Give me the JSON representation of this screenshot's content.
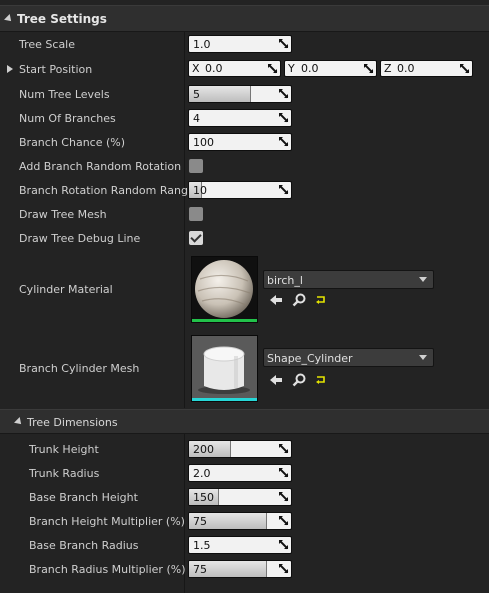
{
  "tree_settings": {
    "title": "Tree Settings",
    "tree_scale": {
      "label": "Tree Scale",
      "value": "1.0",
      "fill": 0
    },
    "start_position": {
      "label": "Start Position",
      "x": {
        "axis": "X",
        "value": "0.0"
      },
      "y": {
        "axis": "Y",
        "value": "0.0"
      },
      "z": {
        "axis": "Z",
        "value": "0.0"
      }
    },
    "num_tree_levels": {
      "label": "Num Tree Levels",
      "value": "5",
      "fill": 0.6
    },
    "num_of_branches": {
      "label": "Num Of Branches",
      "value": "4",
      "fill": 0
    },
    "branch_chance": {
      "label": "Branch Chance (%)",
      "value": "100",
      "fill": 0
    },
    "add_branch_random_rotation": {
      "label": "Add Branch Random Rotation",
      "checked": false
    },
    "branch_rotation_random_range": {
      "label": "Branch Rotation Random Range",
      "value": "10",
      "fill": 0.12
    },
    "draw_tree_mesh": {
      "label": "Draw Tree Mesh",
      "checked": false
    },
    "draw_tree_debug_line": {
      "label": "Draw Tree Debug Line",
      "checked": true
    },
    "cylinder_material": {
      "label": "Cylinder Material",
      "value": "birch_l",
      "accent": "#22c24a"
    },
    "branch_cylinder_mesh": {
      "label": "Branch Cylinder Mesh",
      "value": "Shape_Cylinder",
      "accent": "#27d6d6"
    }
  },
  "tree_dimensions": {
    "title": "Tree Dimensions",
    "trunk_height": {
      "label": "Trunk Height",
      "value": "200",
      "fill": 0.4
    },
    "trunk_radius": {
      "label": "Trunk Radius",
      "value": "2.0",
      "fill": 0
    },
    "base_branch_height": {
      "label": "Base Branch Height",
      "value": "150",
      "fill": 0.28
    },
    "branch_height_multiplier": {
      "label": "Branch Height Multiplier (%)",
      "value": "75",
      "fill": 0.75
    },
    "base_branch_radius": {
      "label": "Base Branch Radius",
      "value": "1.5",
      "fill": 0
    },
    "branch_radius_multiplier": {
      "label": "Branch Radius Multiplier (%)",
      "value": "75",
      "fill": 0.75
    }
  },
  "icons": {
    "use_selected": "arrow-left-icon",
    "browse": "magnifier-icon",
    "reset": "reset-arrow-icon"
  },
  "colors": {
    "panel_bg": "#232323",
    "header_bg": "#2f2f2f",
    "field_bg": "#f2f2f2",
    "reset_icon": "#e6e600"
  }
}
